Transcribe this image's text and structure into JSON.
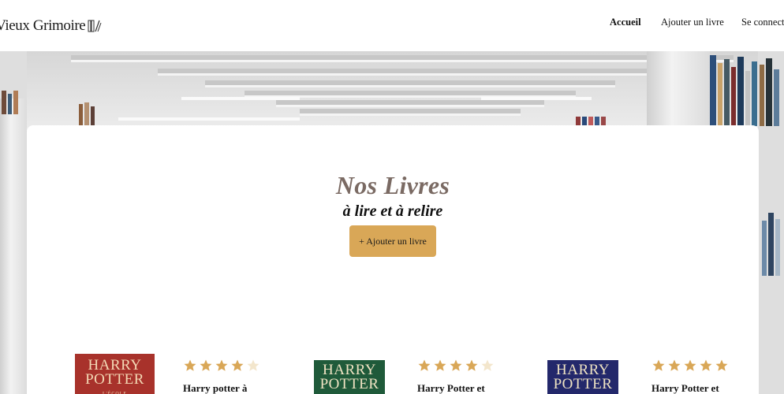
{
  "header": {
    "logo_text": "on Vieux Grimoire",
    "nav": [
      {
        "label": "Accueil",
        "active": true
      },
      {
        "label": "Ajouter un livre",
        "active": false
      },
      {
        "label": "Se connecte",
        "active": false
      }
    ]
  },
  "hero": {
    "title": "Nos Livres",
    "subtitle": "à lire et à relire",
    "add_button_label": "+ Ajouter un livre"
  },
  "books": [
    {
      "cover_line1": "HARRY",
      "cover_line2": "POTTER",
      "cover_line3": "L'ÉCOLE",
      "cover_color": "#a8322b",
      "rating": 4,
      "max_rating": 5,
      "title": "Harry potter à"
    },
    {
      "cover_line1": "HARRY",
      "cover_line2": "POTTER",
      "cover_line3": "",
      "cover_color": "#1f5a3a",
      "rating": 4,
      "max_rating": 5,
      "title": "Harry Potter et"
    },
    {
      "cover_line1": "HARRY",
      "cover_line2": "POTTER",
      "cover_line3": "",
      "cover_color": "#23286b",
      "rating": 5,
      "max_rating": 5,
      "title": "Harry Potter et"
    }
  ],
  "colors": {
    "accent": "#d9a757",
    "star_filled": "#d9a757",
    "star_empty": "#f3e6cc",
    "title": "#7a6a63"
  }
}
